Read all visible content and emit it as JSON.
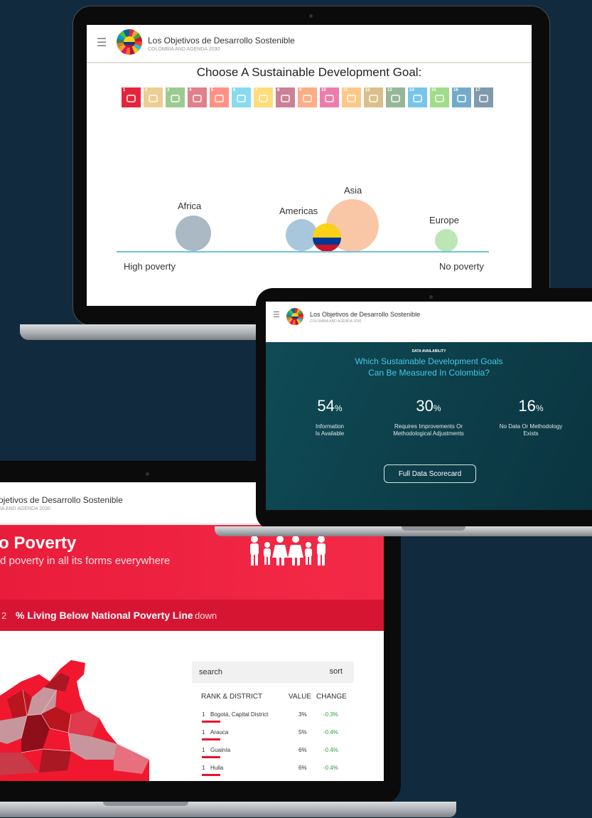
{
  "colors": {
    "background": "#122a3d",
    "accent_red": "#e5243b",
    "teal": "#0f4b56"
  },
  "app": {
    "title": "Los Objetivos de Desarrollo Sostenible",
    "subtitle": "COLOMBIA AND AGENDA 2030"
  },
  "goal_screen": {
    "heading": "Choose A Sustainable Development Goal:",
    "goals": [
      {
        "number": "1",
        "color": "#e5243b"
      },
      {
        "number": "2",
        "color": "#dda63a"
      },
      {
        "number": "3",
        "color": "#4c9f38"
      },
      {
        "number": "4",
        "color": "#c5192d"
      },
      {
        "number": "5",
        "color": "#ff3a21"
      },
      {
        "number": "6",
        "color": "#26bde2"
      },
      {
        "number": "7",
        "color": "#fcc30b"
      },
      {
        "number": "8",
        "color": "#a21942"
      },
      {
        "number": "9",
        "color": "#fd6925"
      },
      {
        "number": "10",
        "color": "#dd1367"
      },
      {
        "number": "11",
        "color": "#fd9d24"
      },
      {
        "number": "12",
        "color": "#bf8b2e"
      },
      {
        "number": "13",
        "color": "#3f7e44"
      },
      {
        "number": "14",
        "color": "#0a97d9"
      },
      {
        "number": "15",
        "color": "#56c02b"
      },
      {
        "number": "16",
        "color": "#00689d"
      },
      {
        "number": "17",
        "color": "#19486a"
      }
    ],
    "regions": {
      "africa": "Africa",
      "americas": "Americas",
      "asia": "Asia",
      "europe": "Europe"
    },
    "axis_left": "High poverty",
    "axis_right": "No poverty"
  },
  "data_screen": {
    "eyebrow": "DATA AVAILABILITY",
    "title_line1": "Which Sustainable Development Goals",
    "title_line2": "Can Be Measured In Colombia?",
    "stats": [
      {
        "value": "54",
        "unit": "%",
        "caption_line1": "Information",
        "caption_line2": "Is Available"
      },
      {
        "value": "30",
        "unit": "%",
        "caption_line1": "Requires Improvements Or",
        "caption_line2": "Methodological Adjustments"
      },
      {
        "value": "16",
        "unit": "%",
        "caption_line1": "No Data Or Methodology",
        "caption_line2": "Exists"
      }
    ],
    "button_label": "Full Data Scorecard"
  },
  "poverty_screen": {
    "app_title": "ojetivos de Desarrollo Sostenible",
    "app_subtitle": "IA AND AGENDA 2030",
    "goal_title": "o Poverty",
    "goal_subtitle": "d poverty in all its forms everywhere",
    "indicator_num": "2",
    "indicator_title": "% Living Below National Poverty Line",
    "indicator_dropdown": "down",
    "search_label": "search",
    "sort_label": "sort",
    "columns": {
      "rank": "RANK & DISTRICT",
      "value": "VALUE",
      "change": "CHANGE"
    },
    "rows": [
      {
        "rank": "1",
        "district": "Bogotá, Capital District",
        "value": "3%",
        "change": "-0.3%"
      },
      {
        "rank": "1",
        "district": "Arauca",
        "value": "5%",
        "change": "-0.4%"
      },
      {
        "rank": "1",
        "district": "Guainía",
        "value": "6%",
        "change": "-0.4%"
      },
      {
        "rank": "1",
        "district": "Huila",
        "value": "6%",
        "change": "-0.4%"
      }
    ]
  }
}
